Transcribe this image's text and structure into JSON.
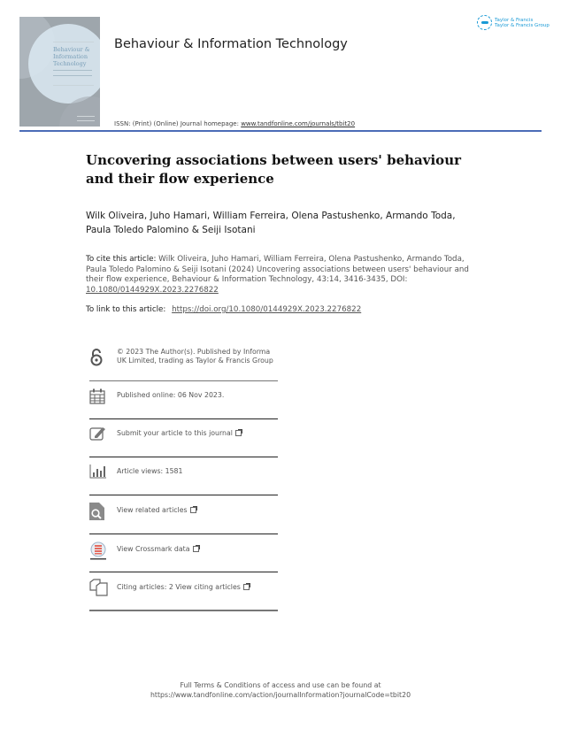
{
  "header": {
    "journal_title": "Behaviour & Information Technology",
    "issn_text": "ISSN: (Print) (Online) Journal homepage:",
    "homepage_link": "www.tandfonline.com/journals/tbit20",
    "publisher_logo": {
      "icon": "taylor-francis-logo-icon",
      "line1": "Taylor & Francis",
      "line2": "Taylor & Francis Group",
      "color": "#1a9ad6"
    },
    "cover": {
      "title_lines": [
        "Behaviour &",
        "Information",
        "Technology"
      ]
    },
    "rule_color": "#4b6cb7"
  },
  "article": {
    "title": "Uncovering associations between users' behaviour and their flow experience",
    "authors": "Wilk Oliveira, Juho Hamari, William Ferreira, Olena Pastushenko, Armando Toda, Paula Toledo Palomino & Seiji Isotani"
  },
  "citation": {
    "label": "To cite this article:",
    "text": "Wilk Oliveira, Juho Hamari, William Ferreira, Olena Pastushenko, Armando Toda, Paula Toledo Palomino & Seiji Isotani (2024) Uncovering associations between users' behaviour and their flow experience, Behaviour & Information Technology, 43:14, 3416-3435, DOI:",
    "doi": "10.1080/0144929X.2023.2276822",
    "link_label": "To link to this article:",
    "link_url": "https://doi.org/10.1080/0144929X.2023.2276822"
  },
  "meta_items": [
    {
      "icon": "open-access-icon",
      "text": "© 2023 The Author(s). Published by Informa UK Limited, trading as Taylor & Francis Group",
      "external": false
    },
    {
      "icon": "calendar-icon",
      "text": "Published online: 06 Nov 2023.",
      "external": false
    },
    {
      "icon": "edit-icon",
      "text": "Submit your article to this journal",
      "external": true
    },
    {
      "icon": "bar-chart-icon",
      "text": "Article views: 1581",
      "external": false
    },
    {
      "icon": "search-document-icon",
      "text": "View related articles",
      "external": true
    },
    {
      "icon": "crossmark-icon",
      "text": "View Crossmark data",
      "external": true
    },
    {
      "icon": "citing-articles-icon",
      "text": "Citing articles: 2 View citing articles",
      "external": true
    }
  ],
  "footer": {
    "line1": "Full Terms & Conditions of access and use can be found at",
    "line2": "https://www.tandfonline.com/action/journalInformation?journalCode=tbit20"
  }
}
